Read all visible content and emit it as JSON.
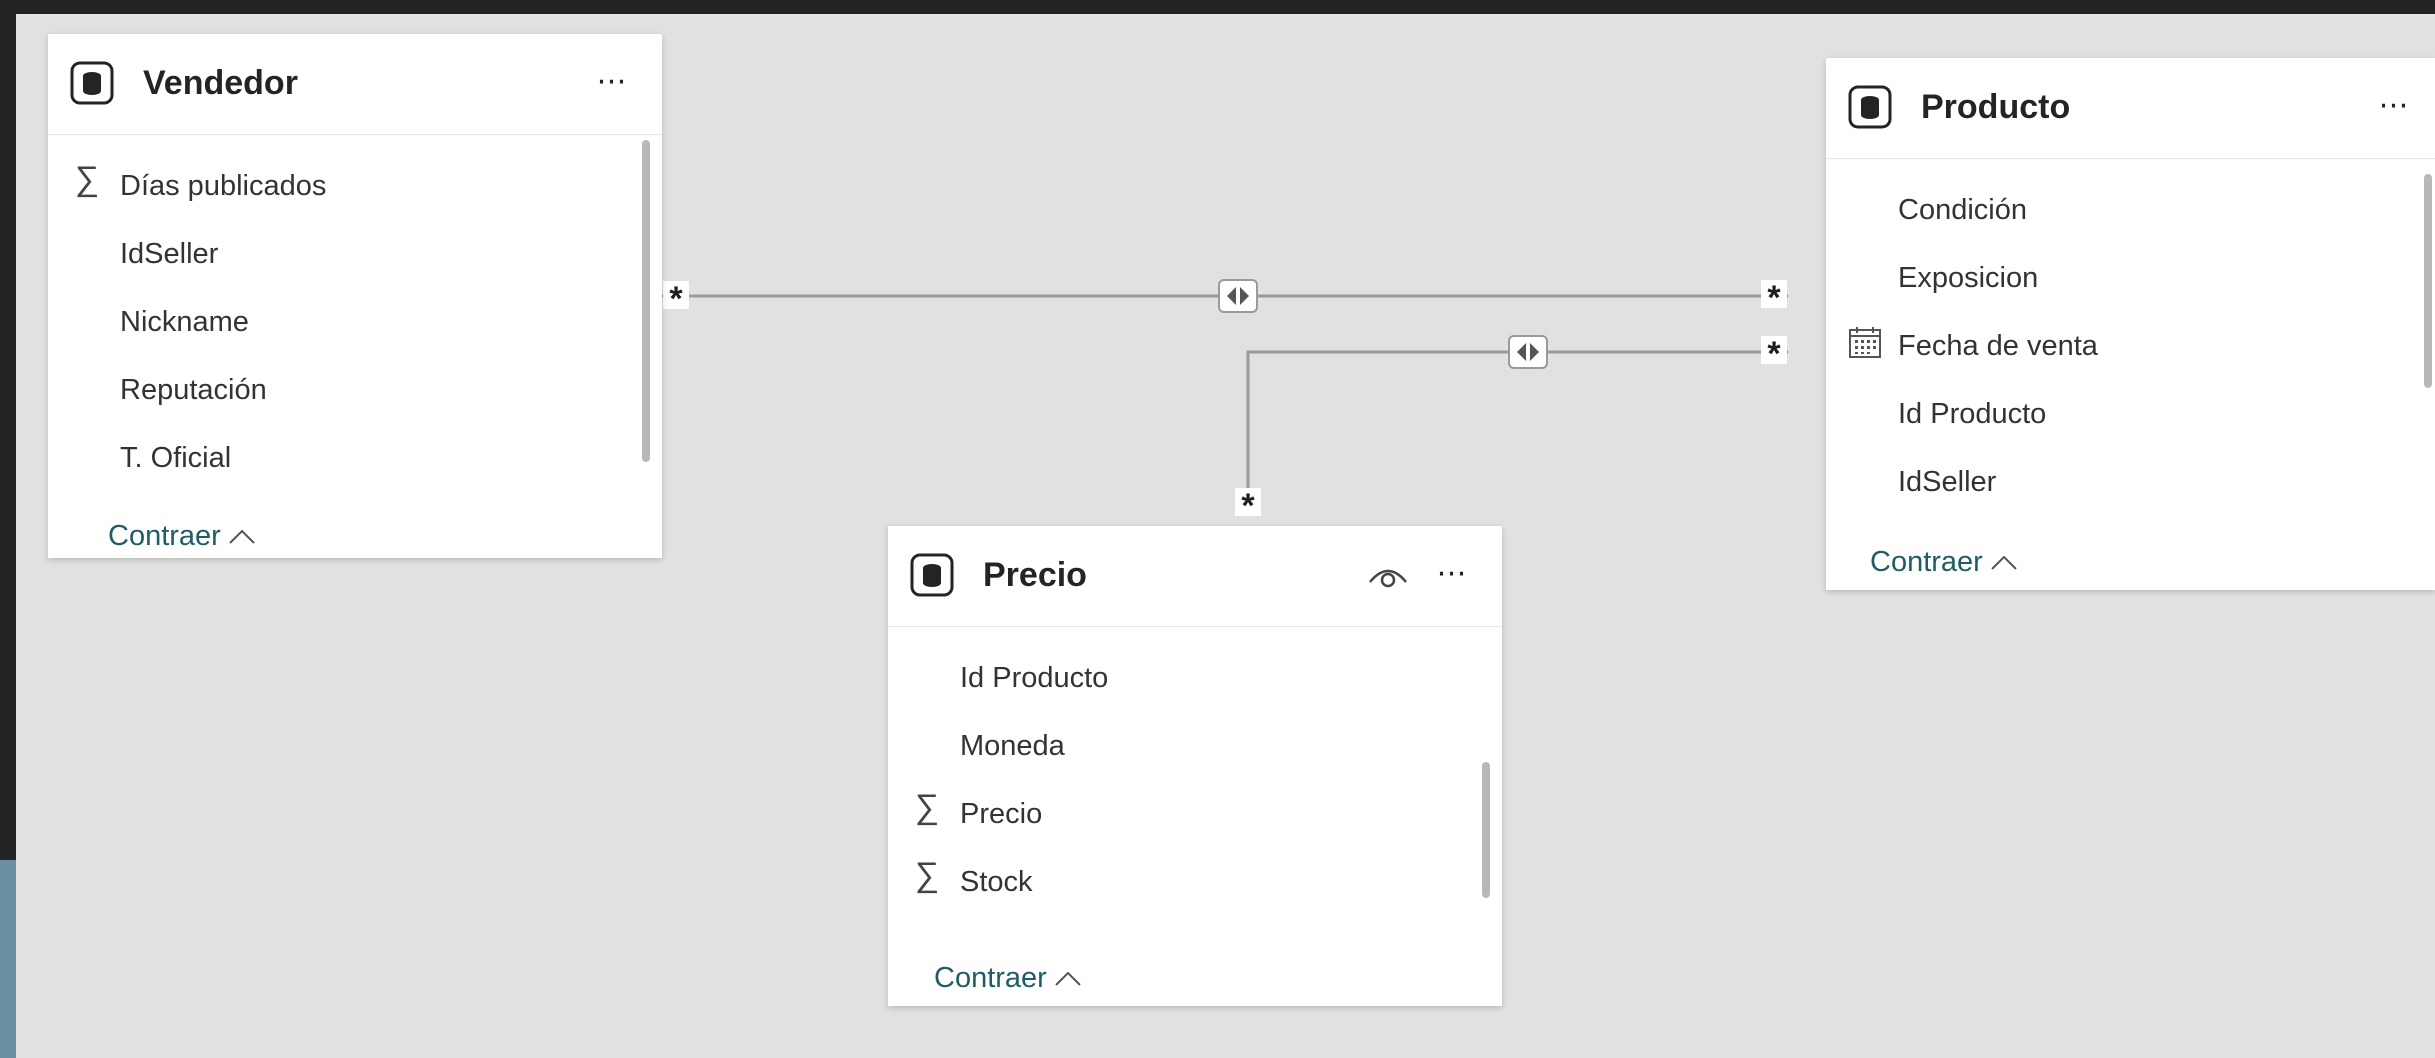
{
  "colors": {
    "window_bg": "#232323",
    "canvas_bg": "#e3e1df",
    "card_bg": "#ffffff",
    "link": "#1f5c66",
    "line": "#9a9a9a"
  },
  "tables": {
    "vendedor": {
      "title": "Vendedor",
      "icon": "database-table-icon",
      "fields": [
        {
          "label": "Días publicados",
          "icon": "sigma"
        },
        {
          "label": "IdSeller",
          "icon": ""
        },
        {
          "label": "Nickname",
          "icon": ""
        },
        {
          "label": "Reputación",
          "icon": ""
        },
        {
          "label": "T. Oficial",
          "icon": ""
        }
      ],
      "collapse": "Contraer"
    },
    "producto": {
      "title": "Producto",
      "icon": "database-table-icon",
      "fields": [
        {
          "label": "Condición",
          "icon": ""
        },
        {
          "label": "Exposicion",
          "icon": ""
        },
        {
          "label": "Fecha de venta",
          "icon": "calendar"
        },
        {
          "label": "Id Producto",
          "icon": ""
        },
        {
          "label": "IdSeller",
          "icon": ""
        }
      ],
      "collapse": "Contraer"
    },
    "precio": {
      "title": "Precio",
      "icon": "database-table-icon",
      "fields": [
        {
          "label": "Id Producto",
          "icon": ""
        },
        {
          "label": "Moneda",
          "icon": ""
        },
        {
          "label": "Precio",
          "icon": "sigma"
        },
        {
          "label": "Stock",
          "icon": "sigma"
        }
      ],
      "collapse": "Contraer"
    }
  },
  "relationships": {
    "vendedor_producto": {
      "from": "Vendedor",
      "to": "Producto",
      "from_cardinality": "*",
      "to_cardinality": "*",
      "cross_filter": "both"
    },
    "precio_producto": {
      "from": "Precio",
      "to": "Producto",
      "from_cardinality": "*",
      "to_cardinality": "*",
      "cross_filter": "both"
    }
  },
  "common": {
    "more_icon": "⋯",
    "collapse_chevron": "^"
  }
}
